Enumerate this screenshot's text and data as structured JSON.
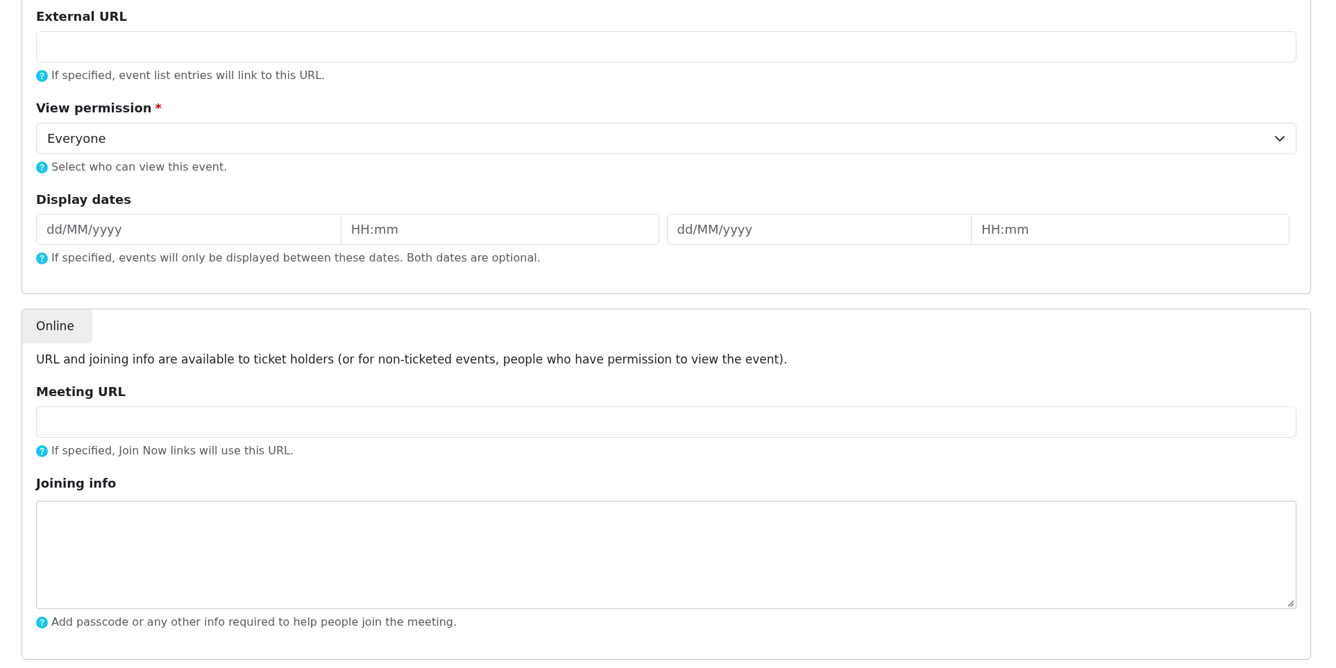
{
  "panels": [
    {
      "fields": [
        {
          "kind": "text",
          "label": "External URL",
          "help": "If specified, event list entries will link to this URL."
        },
        {
          "kind": "select",
          "label": "View permission",
          "required_mark": "*",
          "value": "Everyone",
          "help": "Select who can view this event."
        },
        {
          "kind": "date_range",
          "label": "Display dates",
          "ranges": [
            {
              "date_placeholder": "dd/MM/yyyy",
              "time_placeholder": "HH:mm"
            },
            {
              "date_placeholder": "dd/MM/yyyy",
              "time_placeholder": "HH:mm"
            }
          ],
          "help": "If specified, events will only be displayed between these dates. Both dates are optional."
        }
      ]
    },
    {
      "heading": "Online",
      "intro": "URL and joining info are available to ticket holders (or for non-ticketed events, people who have permission to view the event).",
      "fields": [
        {
          "kind": "text",
          "label": "Meeting URL",
          "help": "If specified, Join Now links will use this URL."
        },
        {
          "kind": "textarea",
          "label": "Joining info",
          "help": "Add passcode or any other info required to help people join the meeting."
        }
      ]
    }
  ]
}
